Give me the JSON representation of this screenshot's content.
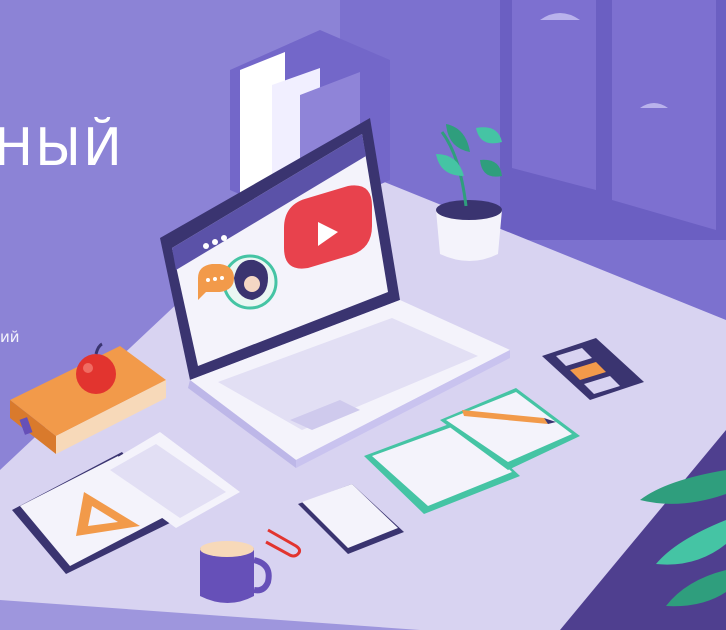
{
  "hero": {
    "title_fragment": "НЫЙ",
    "subtitle_fragment": "ий"
  },
  "colors": {
    "background": "#8c83d6",
    "wall_dark": "#6f63c4",
    "desk_top": "#d8d3f1",
    "desk_side": "#9e96dd",
    "laptop_body": "#f4f3fb",
    "laptop_screen": "#3a3470",
    "play_button": "#e8424d",
    "book_orange": "#f29a4a",
    "apple_red": "#e2342f",
    "plant_green": "#2f9e7d",
    "notebook_teal": "#45c4a4",
    "mug_purple": "#6650b8"
  },
  "icons": [
    "laptop-icon",
    "video-play-icon",
    "chat-bubble-icon",
    "avatar-portrait-icon",
    "apple-icon",
    "book-icon",
    "plant-icon",
    "phone-icon",
    "notebook-icon",
    "pencil-icon",
    "triangle-ruler-icon",
    "mug-icon",
    "paperclip-icon",
    "folder-icon",
    "window-icon",
    "leaf-icon"
  ]
}
